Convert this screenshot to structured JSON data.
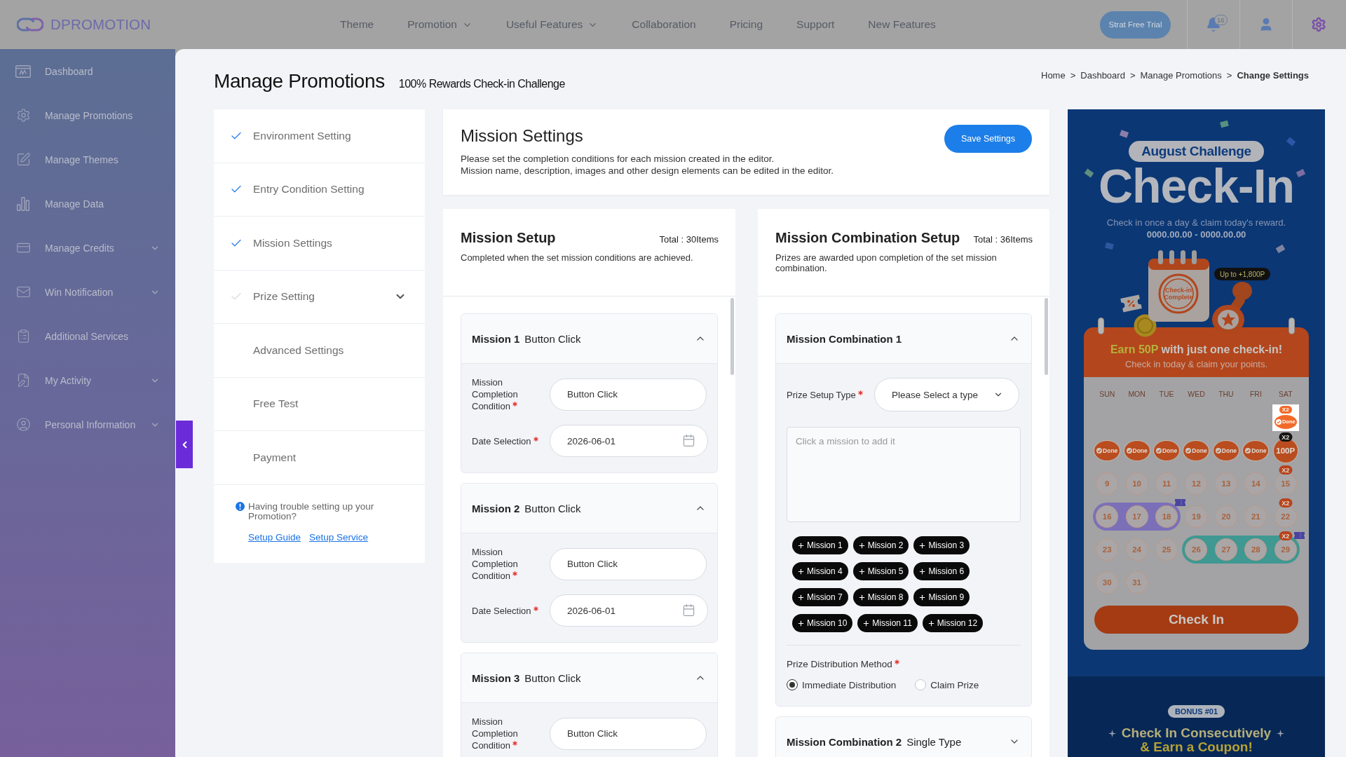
{
  "header": {
    "logo": "DPROMOTION",
    "nav": [
      {
        "label": "Theme",
        "dropdown": false
      },
      {
        "label": "Promotion",
        "dropdown": true
      },
      {
        "label": "Useful Features",
        "dropdown": true
      },
      {
        "label": "Collaboration",
        "dropdown": false
      },
      {
        "label": "Pricing",
        "dropdown": false
      },
      {
        "label": "Support",
        "dropdown": false
      },
      {
        "label": "New Features",
        "dropdown": false
      }
    ],
    "trial_button": "Strat Free Trial",
    "notification_count": "16"
  },
  "sidebar": {
    "items": [
      {
        "label": "Dashboard",
        "expandable": false
      },
      {
        "label": "Manage Promotions",
        "expandable": false
      },
      {
        "label": "Manage Themes",
        "expandable": false
      },
      {
        "label": "Manage Data",
        "expandable": false
      },
      {
        "label": "Manage Credits",
        "expandable": true
      },
      {
        "label": "Win Notification",
        "expandable": true
      },
      {
        "label": "Additional Services",
        "expandable": false
      },
      {
        "label": "My Activity",
        "expandable": true
      },
      {
        "label": "Personal Information",
        "expandable": true
      }
    ]
  },
  "page": {
    "title": "Manage Promotions",
    "subtitle": "100% Rewards Check-in Challenge",
    "breadcrumb": {
      "separator": ">",
      "items": [
        {
          "label": "Home",
          "current": false
        },
        {
          "label": "Dashboard",
          "current": false
        },
        {
          "label": "Manage Promotions",
          "current": false
        },
        {
          "label": "Change Settings",
          "current": true
        }
      ]
    }
  },
  "steps": {
    "items": [
      {
        "label": "Environment Setting",
        "kind": "step",
        "checked": true,
        "expandable": false
      },
      {
        "label": "Entry Condition Setting",
        "kind": "step",
        "checked": true,
        "expandable": false
      },
      {
        "label": "Mission Settings",
        "kind": "step",
        "checked": true,
        "expandable": false
      },
      {
        "label": "Prize Setting",
        "kind": "step",
        "checked": false,
        "expandable": true
      },
      {
        "label": "Advanced Settings",
        "kind": "plain",
        "expandable": false
      },
      {
        "label": "Free Test",
        "kind": "plain",
        "expandable": false
      },
      {
        "label": "Payment",
        "kind": "plain",
        "expandable": false
      }
    ],
    "help": {
      "text": "Having trouble setting up your Promotion?",
      "links": [
        "Setup Guide",
        "Setup Service"
      ]
    }
  },
  "mission_settings": {
    "title": "Mission Settings",
    "description": [
      "Please set the completion conditions for each mission created in the editor.",
      "Mission name, description, images and other design elements can be edited in the editor."
    ],
    "save_button": "Save Settings"
  },
  "mission_setup": {
    "title": "Mission Setup",
    "total": "Total : 30Items",
    "description": "Completed when the set mission conditions are achieved.",
    "missions": [
      {
        "name": "Mission 1",
        "type": "Button Click",
        "expanded": true,
        "fields": [
          {
            "kind": "text",
            "label": "Mission Completion Condition",
            "required": true,
            "value": "Button Click"
          },
          {
            "kind": "date",
            "label": "Date Selection",
            "required": true,
            "value": "2026-06-01"
          }
        ]
      },
      {
        "name": "Mission 2",
        "type": "Button Click",
        "expanded": true,
        "fields": [
          {
            "kind": "text",
            "label": "Mission Completion Condition",
            "required": true,
            "value": "Button Click"
          },
          {
            "kind": "date",
            "label": "Date Selection",
            "required": true,
            "value": "2026-06-01"
          }
        ]
      },
      {
        "name": "Mission 3",
        "type": "Button Click",
        "expanded": true,
        "fields": [
          {
            "kind": "text",
            "label": "Mission Completion Condition",
            "required": true,
            "value": "Button Click"
          }
        ]
      }
    ]
  },
  "mission_combination_setup": {
    "title": "Mission Combination Setup",
    "total": "Total : 36Items",
    "description": "Prizes are awarded upon completion of the set mission combination.",
    "combinations": [
      {
        "title": "Mission Combination 1",
        "expanded": true,
        "prize_setup_type": {
          "label": "Prize Setup Type",
          "required": true,
          "placeholder": "Please Select a type"
        },
        "missions_field": {
          "placeholder": "Click a mission to add it"
        },
        "mission_buttons": [
          "Mission 1",
          "Mission 2",
          "Mission 3",
          "Mission 4",
          "Mission 5",
          "Mission 6",
          "Mission 7",
          "Mission 8",
          "Mission 9",
          "Mission 10",
          "Mission 11",
          "Mission 12"
        ],
        "prize_distribution": {
          "label": "Prize Distribution Method",
          "required": true,
          "options": [
            {
              "label": "Immediate Distribution",
              "selected": true
            },
            {
              "label": "Claim Prize",
              "selected": false
            }
          ]
        }
      },
      {
        "title": "Mission Combination 2",
        "type": "Single Type",
        "expanded": false
      }
    ]
  },
  "preview": {
    "badge": "August Challenge",
    "title": "Check-In",
    "subtitle": "Check in once a day & claim today's reward.",
    "period": "0000.00.00 - 0000.00.00",
    "illustration_label": "Check-in Complete",
    "reward_tag": "Up to +1,800P",
    "calendar": {
      "headline_highlight": "Earn 50P",
      "headline": "with just one check-in!",
      "subline": "Check in today & claim your points.",
      "weekdays": [
        "SUN",
        "MON",
        "TUE",
        "WED",
        "THU",
        "FRI",
        "SAT"
      ],
      "weeks": [
        {
          "cells": [
            {
              "kind": "blank"
            },
            {
              "kind": "blank"
            },
            {
              "kind": "blank"
            },
            {
              "kind": "blank"
            },
            {
              "kind": "blank"
            },
            {
              "kind": "blank"
            },
            {
              "kind": "framed_stamp",
              "label": "Done",
              "bonus": "X2",
              "coupon": false
            }
          ]
        },
        {
          "cells": [
            {
              "kind": "stamp",
              "label": "Done",
              "coupon": false
            },
            {
              "kind": "stamp",
              "label": "Done",
              "coupon": false
            },
            {
              "kind": "stamp",
              "label": "Done",
              "coupon": false
            },
            {
              "kind": "stamp",
              "label": "Done",
              "coupon": false
            },
            {
              "kind": "stamp",
              "label": "Done",
              "coupon": false
            },
            {
              "kind": "stamp",
              "label": "Done",
              "coupon": false
            },
            {
              "kind": "reward",
              "label": "100P",
              "bonus": "X2",
              "coupon": false
            }
          ]
        },
        {
          "cells": [
            {
              "kind": "day",
              "label": "9",
              "coupon": false
            },
            {
              "kind": "day",
              "label": "10",
              "coupon": false
            },
            {
              "kind": "day",
              "label": "11",
              "coupon": false
            },
            {
              "kind": "day",
              "label": "12",
              "coupon": false
            },
            {
              "kind": "day",
              "label": "13",
              "coupon": false
            },
            {
              "kind": "day",
              "label": "14",
              "coupon": false
            },
            {
              "kind": "day",
              "label": "15",
              "bonus": "X2",
              "coupon": false
            }
          ]
        },
        {
          "cells": [
            {
              "kind": "day",
              "label": "16",
              "color": "#7b70b8",
              "coupon": false
            },
            {
              "kind": "day",
              "label": "17",
              "color": "#7b70b8",
              "coupon": false
            },
            {
              "kind": "day",
              "label": "18",
              "color": "#7b70b8",
              "coupon": true
            },
            {
              "kind": "day",
              "label": "19",
              "coupon": false
            },
            {
              "kind": "day",
              "label": "20",
              "coupon": false
            },
            {
              "kind": "day",
              "label": "21",
              "coupon": false
            },
            {
              "kind": "day",
              "label": "22",
              "bonus": "X2",
              "coupon": false
            }
          ]
        },
        {
          "cells": [
            {
              "kind": "day",
              "label": "23",
              "coupon": false
            },
            {
              "kind": "day",
              "label": "24",
              "coupon": false
            },
            {
              "kind": "day",
              "label": "25",
              "coupon": false
            },
            {
              "kind": "day",
              "label": "26",
              "color": "#3f9892",
              "coupon": false
            },
            {
              "kind": "day",
              "label": "27",
              "color": "#3f9892",
              "coupon": false
            },
            {
              "kind": "day",
              "label": "28",
              "color": "#3f9892",
              "coupon": false
            },
            {
              "kind": "day",
              "label": "29",
              "color": "#3f9892",
              "bonus": "X2",
              "coupon": true
            }
          ]
        },
        {
          "cells": [
            {
              "kind": "day",
              "label": "30",
              "coupon": false
            },
            {
              "kind": "day",
              "label": "31",
              "coupon": false
            },
            {
              "kind": "blank"
            },
            {
              "kind": "blank"
            },
            {
              "kind": "blank"
            },
            {
              "kind": "blank"
            },
            {
              "kind": "blank"
            }
          ]
        }
      ],
      "button": "Check In"
    },
    "bonus": {
      "badge": "BONUS #01",
      "title": "Check In Consecutively",
      "subtitle": "& Earn a Coupon!"
    }
  }
}
